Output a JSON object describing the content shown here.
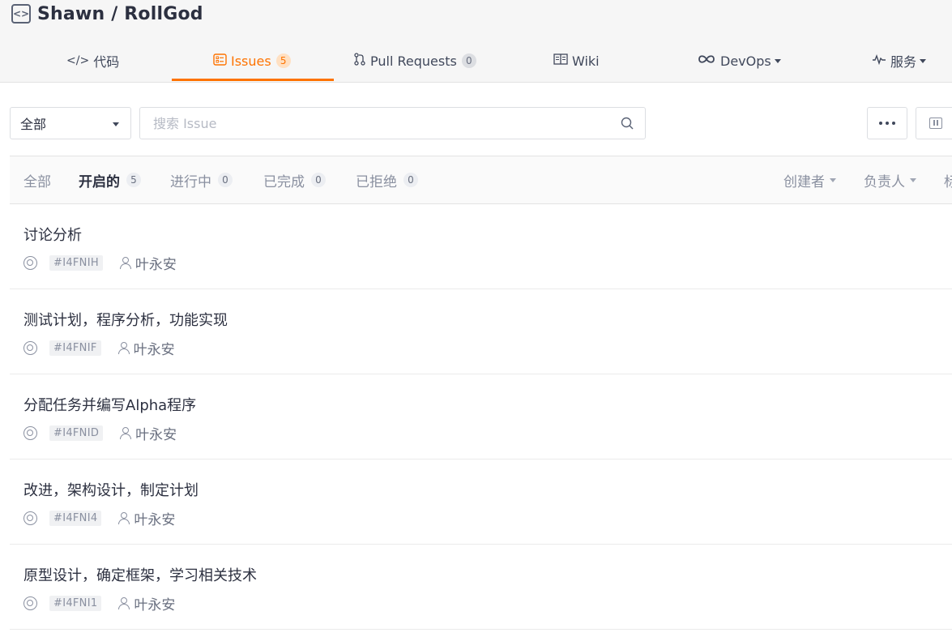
{
  "repo": {
    "title": "Shawn / RollGod",
    "icon": "code-box-icon"
  },
  "tabs": [
    {
      "label": "代码",
      "icon": "</>"
    },
    {
      "label": "Issues",
      "icon": "issues-icon",
      "count": "5"
    },
    {
      "label": "Pull Requests",
      "icon": "pull-request-icon",
      "count": "0"
    },
    {
      "label": "Wiki",
      "icon": "book-icon"
    },
    {
      "label": "DevOps",
      "icon": "infinity-icon"
    },
    {
      "label": "服务",
      "icon": "pulse-icon"
    }
  ],
  "filter": {
    "scope": "全部",
    "search_placeholder": "搜索 Issue"
  },
  "status_tabs": [
    {
      "label": "全部"
    },
    {
      "label": "开启的",
      "count": "5"
    },
    {
      "label": "进行中",
      "count": "0"
    },
    {
      "label": "已完成",
      "count": "0"
    },
    {
      "label": "已拒绝",
      "count": "0"
    }
  ],
  "dropdowns": {
    "creator": "创建者",
    "assignee": "负责人",
    "more": "标"
  },
  "issues": [
    {
      "title": "讨论分析",
      "id": "#I4FNIH",
      "assignee": "叶永安"
    },
    {
      "title": "测试计划，程序分析，功能实现",
      "id": "#I4FNIF",
      "assignee": "叶永安"
    },
    {
      "title": "分配任务并编写Alpha程序",
      "id": "#I4FNID",
      "assignee": "叶永安"
    },
    {
      "title": "改进，架构设计，制定计划",
      "id": "#I4FNI4",
      "assignee": "叶永安"
    },
    {
      "title": "原型设计，确定框架，学习相关技术",
      "id": "#I4FNI1",
      "assignee": "叶永安"
    }
  ],
  "colors": {
    "accent": "#fe7300",
    "text": "#2c3040",
    "muted": "#8a90a0"
  }
}
